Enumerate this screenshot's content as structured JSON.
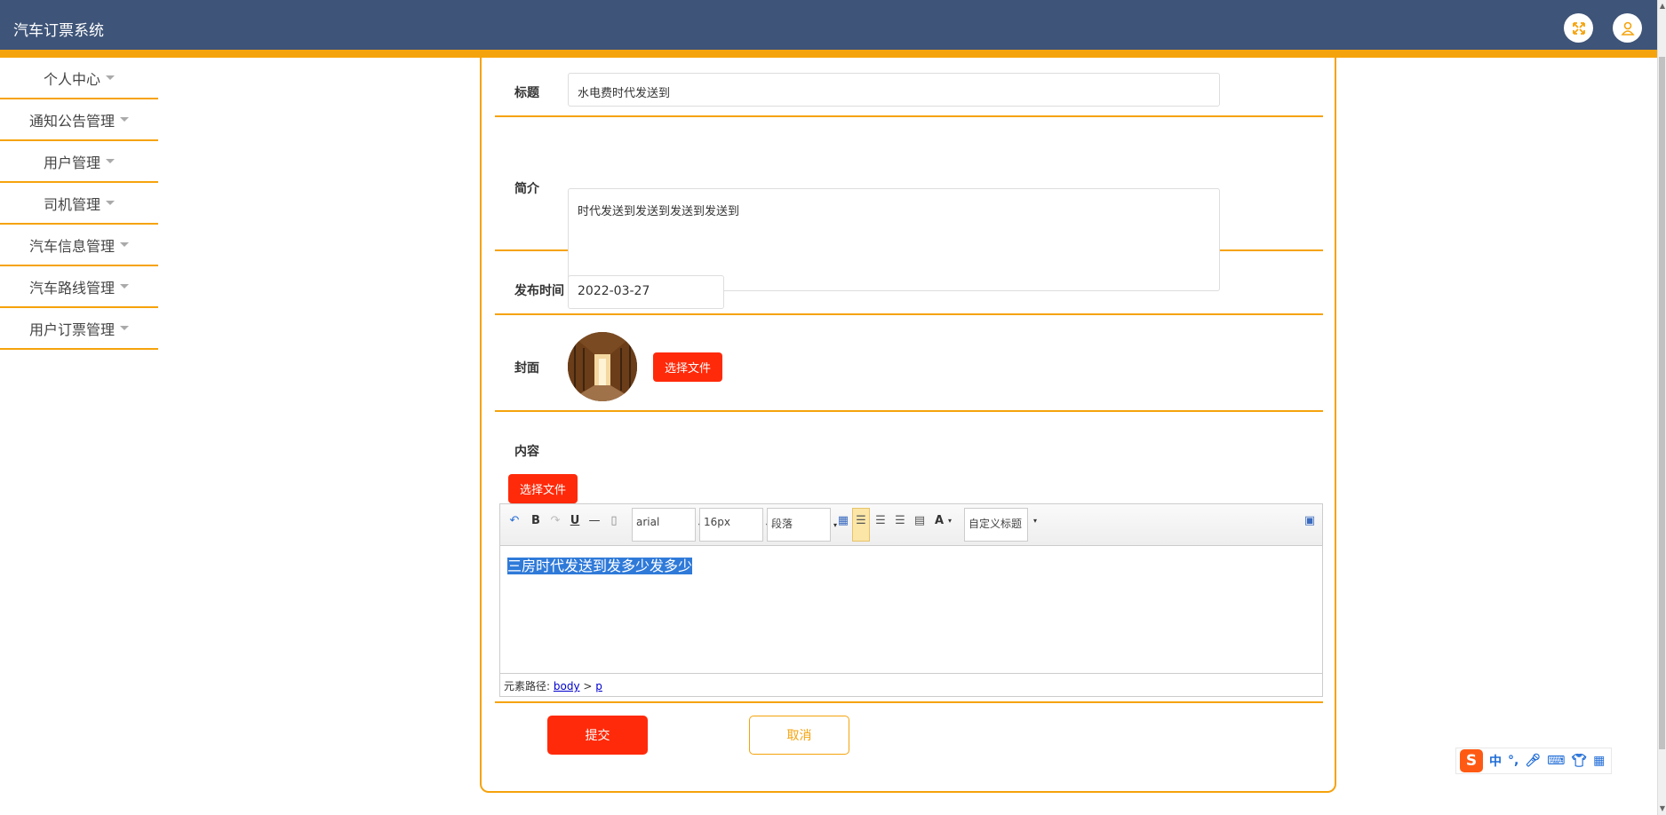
{
  "app": {
    "title": "汽车订票系统"
  },
  "header": {
    "icons": [
      "fullscreen-icon",
      "user-icon"
    ]
  },
  "sidebar": {
    "items": [
      {
        "label": "个人中心"
      },
      {
        "label": "通知公告管理"
      },
      {
        "label": "用户管理"
      },
      {
        "label": "司机管理"
      },
      {
        "label": "汽车信息管理"
      },
      {
        "label": "汽车路线管理"
      },
      {
        "label": "用户订票管理"
      }
    ]
  },
  "form": {
    "title_label": "标题",
    "title_value": "水电费时代发送到",
    "intro_label": "简介",
    "intro_value": "时代发送到发送到发送到发送到",
    "date_label": "发布时间",
    "date_value": "2022-03-27",
    "cover_label": "封面",
    "cover_button": "选择文件",
    "content_label": "内容",
    "content_button": "选择文件",
    "submit_button": "提交",
    "cancel_button": "取消"
  },
  "editor": {
    "bold": "B",
    "underline": "U",
    "font_family": "arial",
    "font_size": "16px",
    "paragraph": "段落",
    "font_color": "A",
    "custom_title": "自定义标题",
    "content": "三房时代发送到发多少发多少",
    "path_label": "元素路径:",
    "path_body": "body",
    "path_sep": ">",
    "path_p": "p"
  },
  "ime": {
    "lang": "中"
  },
  "colors": {
    "header": "#3e5478",
    "accent": "#f5a30c",
    "button_red": "#ff2a0a",
    "selection": "#2f7ad9"
  }
}
